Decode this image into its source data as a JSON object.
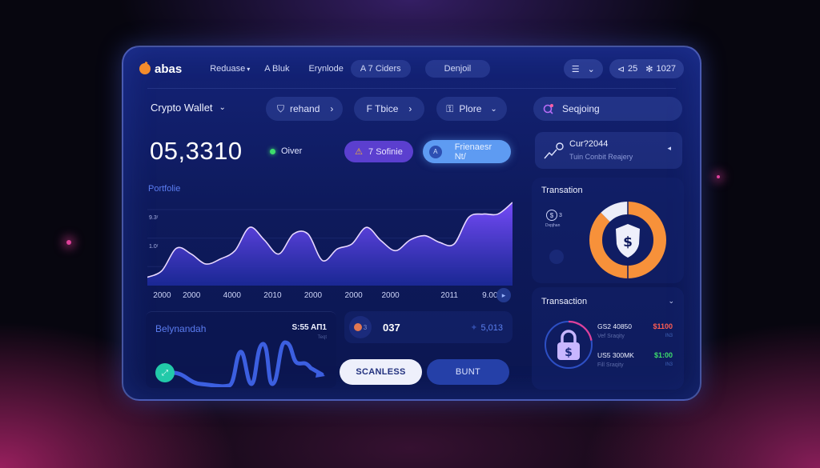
{
  "header": {
    "brand": "abas",
    "nav": [
      "Reduase",
      "A Bluk",
      "Erynlode",
      "A 7 Ciders"
    ],
    "nav_dropdown_arrow": "▾",
    "primary_button": "Denjoil",
    "menu_icon": "☰",
    "menu_chevron": "⌄",
    "stats": [
      {
        "icon": "share-icon",
        "glyph": "⊲",
        "value": "25"
      },
      {
        "icon": "gear-icon",
        "glyph": "✻",
        "value": "1027"
      }
    ]
  },
  "toolbar": {
    "wallet_select": "Crypto Wallet",
    "wallet_chevron": "⌄",
    "chips": [
      {
        "label": "rehand",
        "icon": "shield-icon",
        "glyph": "⛉",
        "trail": "›"
      },
      {
        "label": "F Tbice",
        "icon": "",
        "glyph": "",
        "trail": "›"
      },
      {
        "label": "Plore",
        "icon": "lock-icon",
        "glyph": "⚿",
        "trail": "⌄"
      }
    ],
    "search_placeholder": "Seqjoing"
  },
  "summary": {
    "balance": "05,3310",
    "status_label": "Oiver",
    "status_color": "#3ddc6c",
    "action_purple": {
      "glyph": "⚠",
      "label": "7 Sofinie"
    },
    "action_blue": {
      "glyph": "A",
      "label": "Frienaesr Nt/"
    }
  },
  "current_card": {
    "title": "Cur?2044",
    "subtitle": "Tuin Conbit Reajery",
    "arrow": "◂"
  },
  "chart_data": {
    "type": "area",
    "title": "Portfolie",
    "xlabel": "",
    "ylabel": "",
    "y_tick_labels": [
      "9.3ʳ",
      "1.0ʳ"
    ],
    "x_tick_labels": [
      "2000",
      "2000",
      "4000",
      "2010",
      "2000",
      "2000",
      "2000",
      "2011",
      "9.00"
    ],
    "ylim": [
      0,
      100
    ],
    "x": [
      0,
      4,
      8,
      12,
      16,
      20,
      24,
      28,
      32,
      36,
      40,
      44,
      48,
      52,
      56,
      60,
      64,
      68,
      72,
      76,
      80,
      84,
      88,
      92,
      96,
      100
    ],
    "values": [
      10,
      18,
      45,
      38,
      26,
      32,
      42,
      70,
      55,
      38,
      62,
      62,
      30,
      44,
      50,
      70,
      54,
      42,
      55,
      60,
      52,
      50,
      82,
      86,
      86,
      100
    ],
    "grid": true,
    "legend": "none",
    "series_colors": {
      "line": "#e8d8ff",
      "fill_top": "#7a4dff",
      "fill_bottom": "#1c2a9e"
    }
  },
  "activity_card": {
    "name": "Belynandah",
    "time": "S:55 AΠ1",
    "sub": "Teqt",
    "button_glyph": "⤢"
  },
  "token_row": {
    "badge_count": "3",
    "value": "037",
    "delta": "5,013",
    "delta_glyph": "✦"
  },
  "buttons": {
    "secondary": "SCANLESS",
    "primary": "BUNT"
  },
  "security_card": {
    "title": "Transation",
    "icon_glyph": "$",
    "icon_count": "3",
    "icon_label": "Dvpjhan",
    "donut": {
      "segments": [
        {
          "label": "orange",
          "value": 87.5,
          "color": "#f7913a"
        },
        {
          "label": "light",
          "value": 12.5,
          "color": "#eceef8"
        }
      ],
      "center_glyph": "$"
    }
  },
  "transactions": {
    "title": "Transaction",
    "chevron": "⌄",
    "lock_progress": 0.22,
    "items": [
      {
        "name": "GS2 40850",
        "sub": "Vef Sraqity",
        "amount": "$1100",
        "amount_color": "#ff5c52",
        "amount_sub": "IN3"
      },
      {
        "name": "US5 300MK",
        "sub": "Fill Sraqity",
        "amount": "$1:00",
        "amount_color": "#3ddc6c",
        "amount_sub": "IN3"
      }
    ]
  }
}
